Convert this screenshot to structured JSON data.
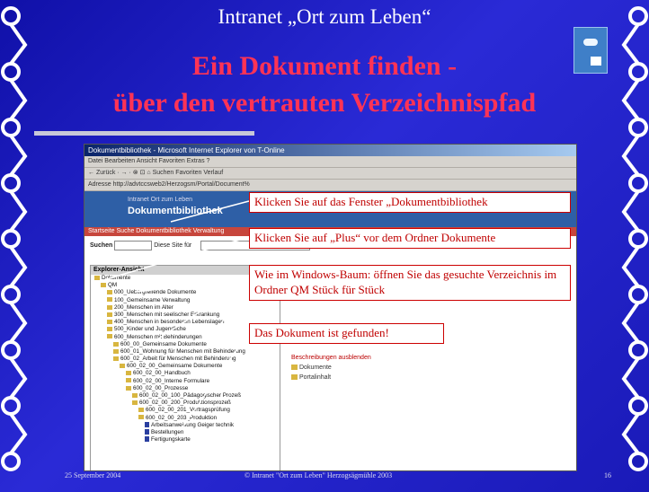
{
  "slide": {
    "title": "Intranet „Ort zum Leben“",
    "heading_line1": "Ein Dokument finden -",
    "heading_line2": "über den vertrauten Verzeichnispfad"
  },
  "browser": {
    "window_title": "Dokumentbibliothek - Microsoft Internet Explorer von T-Online",
    "menu": "Datei  Bearbeiten  Ansicht  Favoriten  Extras  ?",
    "toolbar": "← Zurück · → · ⊗ ⊡ ⌂   Suchen  Favoriten  Verlauf",
    "address_label": "Adresse",
    "address_value": "http://advtccsweb2/Herzogsm/Portal/Document%",
    "banner_small": "Intranet Ort zum Leben",
    "banner_title": "Dokumentbibliothek",
    "nav_items": "Startseite   Suche   Dokumentbibliothek   Verwaltung",
    "search_label": "Suchen",
    "search_scope": "Diese Site",
    "search_for": "für",
    "tree_header": "Explorer-Ansicht",
    "tree": [
      "Dokumente",
      "QM",
      "000_Uebergreifende Dokumente",
      "100_Gemeinsame Verwaltung",
      "200_Menschen im Alter",
      "300_Menschen mit seelischer Erkrankung",
      "400_Menschen in besonderen Lebenslagen",
      "500_Kinder und Jugendliche",
      "600_Menschen mit Behinderungen",
      "600_00_Gemeinsame Dokumente",
      "600_01_Wohnung für Menschen mit Behinderung",
      "600_02_Arbeit für Menschen mit Behinderung",
      "600_02_00_Gemeinsame Dokumente",
      "600_02_00_Handbuch",
      "600_02_00_Interne Formulare",
      "600_02_00_Prozesse",
      "600_02_00_100_Pädagogischer Prozeß",
      "600_02_00_200_Produktionsprozeß",
      "600_02_00_201_Vertragsprüfung",
      "600_02_00_203_Produktion",
      "Arbeitsanweisung Geiger technik",
      "Bestellungen",
      "Fertigungskarte"
    ],
    "right_pane": {
      "hide": "Beschreibungen ausblenden",
      "item1": "Dokumente",
      "item2": "Portalinhalt"
    }
  },
  "callouts": {
    "c1": "Klicken Sie auf das Fenster „Dokumentbibliothek",
    "c2": "Klicken Sie auf „Plus“ vor dem Ordner Dokumente",
    "c3": "Wie im Windows-Baum: öffnen Sie das gesuchte Verzeichnis im Ordner QM Stück für Stück",
    "c4": "Das Dokument ist gefunden!"
  },
  "footer": {
    "date": "25 September 2004",
    "center": "© Intranet \"Ort zum Leben\"  Herzogsägmühle 2003",
    "page": "16"
  },
  "colors": {
    "background": "#1a1ab8",
    "heading": "#ff3355",
    "callout_text": "#c00000"
  }
}
